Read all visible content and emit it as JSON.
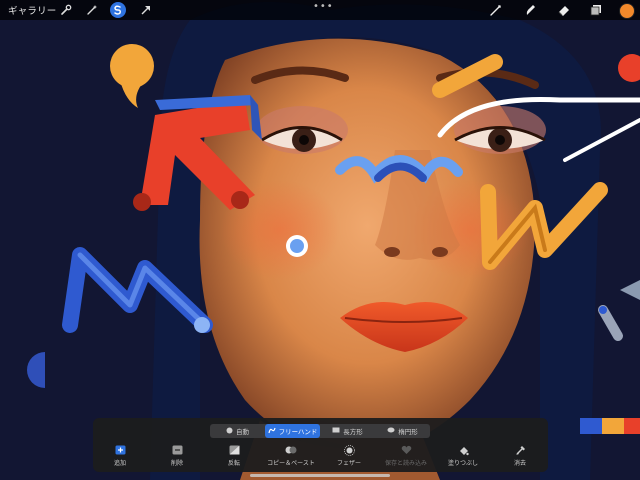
{
  "topbar": {
    "gallery_label": "ギャラリー",
    "icons": [
      "wrench-icon",
      "magic-wand-icon",
      "selection-icon",
      "transform-arrow-icon",
      "brush-icon",
      "smudge-icon",
      "eraser-icon",
      "layers-icon",
      "color-icon"
    ],
    "more_label": "•••",
    "active_color": "#f2892b"
  },
  "selection_modes": [
    {
      "label": "自動",
      "icon": "auto-dot-icon",
      "active": false
    },
    {
      "label": "フリーハンド",
      "icon": "freehand-icon",
      "active": true
    },
    {
      "label": "長方形",
      "icon": "rectangle-icon",
      "active": false
    },
    {
      "label": "楕円形",
      "icon": "ellipse-icon",
      "active": false
    }
  ],
  "actions": [
    {
      "label": "追加",
      "icon": "add-icon",
      "disabled": false
    },
    {
      "label": "削除",
      "icon": "remove-icon",
      "disabled": false
    },
    {
      "label": "反転",
      "icon": "invert-icon",
      "disabled": false
    },
    {
      "label": "コピー＆ペースト",
      "icon": "copy-paste-icon",
      "disabled": false
    },
    {
      "label": "フェザー",
      "icon": "feather-icon",
      "disabled": false
    },
    {
      "label": "保存と読み込み",
      "icon": "save-load-icon",
      "disabled": true
    },
    {
      "label": "塗りつぶし",
      "icon": "fill-icon",
      "disabled": false
    },
    {
      "label": "消去",
      "icon": "clear-icon",
      "disabled": false
    }
  ],
  "colors": {
    "accent": "#2f73e0",
    "panel": "#1c1c1e"
  }
}
